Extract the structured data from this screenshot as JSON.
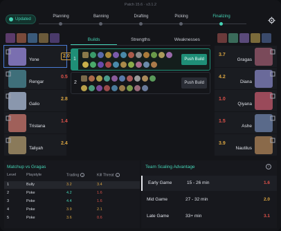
{
  "patch": "Patch 15.6 · v3.1.2",
  "badge": "Updated",
  "phases": [
    {
      "label": "Planning",
      "active": false
    },
    {
      "label": "Banning",
      "active": false
    },
    {
      "label": "Drafting",
      "active": false
    },
    {
      "label": "Picking",
      "active": false
    },
    {
      "label": "Finalizing",
      "active": true
    }
  ],
  "blue_team": [
    {
      "name": "Yone",
      "score": "2.0",
      "color": "#d9a441",
      "selected": true,
      "boxed": true
    },
    {
      "name": "Rengar",
      "score": "0.5",
      "color": "#e0524a",
      "selected": false,
      "boxed": false
    },
    {
      "name": "Galio",
      "score": "2.8",
      "color": "#d9a441",
      "selected": false,
      "boxed": false
    },
    {
      "name": "Tristana",
      "score": "1.4",
      "color": "#e0524a",
      "selected": false,
      "boxed": false
    },
    {
      "name": "Taliyah",
      "score": "2.4",
      "color": "#d9a441",
      "selected": false,
      "boxed": false
    }
  ],
  "red_team": [
    {
      "name": "Gragas",
      "score": "3.7",
      "color": "#d9a441"
    },
    {
      "name": "Diana",
      "score": "4.2",
      "color": "#d9a441"
    },
    {
      "name": "Qiyana",
      "score": "1.0",
      "color": "#e0524a"
    },
    {
      "name": "Ashe",
      "score": "1.5",
      "color": "#e0524a"
    },
    {
      "name": "Nautilus",
      "score": "3.9",
      "color": "#d9a441"
    }
  ],
  "tabs": [
    "Builds",
    "Strengths",
    "Weaknesses"
  ],
  "builds": [
    {
      "num": "1",
      "action": "Push Build"
    },
    {
      "num": "2",
      "action": "Push Build"
    }
  ],
  "matchup": {
    "title": "Matchup vs Gragas",
    "headers": [
      "Level",
      "Playstyle",
      "Trading",
      "Kill Threat"
    ],
    "rows": [
      {
        "level": "1",
        "style": "Bully",
        "trading": "3.2",
        "kill": "3.4",
        "tc": "#d9a441",
        "kc": "#d9a441",
        "selected": true
      },
      {
        "level": "2",
        "style": "Poke",
        "trading": "4.2",
        "kill": "1.6",
        "tc": "#45d3b5",
        "kc": "#e0524a",
        "selected": false
      },
      {
        "level": "3",
        "style": "Poke",
        "trading": "4.4",
        "kill": "1.6",
        "tc": "#45d3b5",
        "kc": "#e0524a",
        "selected": false
      },
      {
        "level": "4",
        "style": "Poke",
        "trading": "3.9",
        "kill": "2.1",
        "tc": "#d9a441",
        "kc": "#d9a441",
        "selected": false
      },
      {
        "level": "5",
        "style": "Poke",
        "trading": "3.6",
        "kill": "0.6",
        "tc": "#d9a441",
        "kc": "#e0524a",
        "selected": false
      }
    ]
  },
  "scaling": {
    "title": "Team Scaling Advantage",
    "rows": [
      {
        "game": "Early Game",
        "time": "15 - 26 min",
        "value": "1.6",
        "color": "#e0524a",
        "selected": true
      },
      {
        "game": "Mid Game",
        "time": "27 - 32 min",
        "value": "2.0",
        "color": "#d9a441",
        "selected": false
      },
      {
        "game": "Late Game",
        "time": "33+ min",
        "value": "3.1",
        "color": "#e0524a",
        "selected": false
      }
    ]
  },
  "colors": {
    "accent": "#45d3b5",
    "gold": "#d9a441",
    "red": "#e0524a"
  }
}
